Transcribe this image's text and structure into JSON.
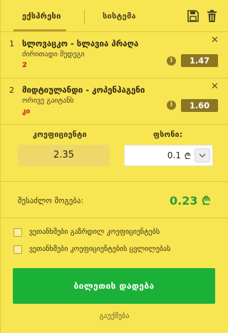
{
  "tabs": [
    {
      "label": "ექსპრესი",
      "active": true
    },
    {
      "label": "სისტემა",
      "active": false
    }
  ],
  "icons": {
    "save": "floppy-disk-icon",
    "trash": "trash-icon",
    "info": "info-icon",
    "close": "close-icon",
    "chevron": "chevron-down-icon"
  },
  "bets": [
    {
      "index": "1",
      "title": "სლოვაცკო - სლავია პრაღა",
      "market": "ძირითადი შედეგი",
      "pick": "2",
      "odds": "1.47"
    },
    {
      "index": "2",
      "title": "მიდტიულანდი - კოპენჰაგენი",
      "market": "ორივე გაიტანს",
      "pick": "კი",
      "odds": "1.60"
    }
  ],
  "calc": {
    "coef_label": "კოეფიციენტი",
    "coef_value": "2.35",
    "stake_label": "ფსონი:",
    "stake_value": "0.1",
    "currency": "₾"
  },
  "win": {
    "label": "შესაძლო მოგება:",
    "value": "0.23",
    "currency": "₾"
  },
  "options": [
    {
      "label": "ვეთანხმები გაზრდილ კოეფიციენტებს",
      "checked": false
    },
    {
      "label": "ვეთანხმები კოეფიციენტების ცვლილებას",
      "checked": false
    }
  ],
  "actions": {
    "place_bet": "ბილეთის დადება",
    "cancel": "გაუქმება"
  },
  "colors": {
    "background": "#f8e552",
    "odds_badge": "#8c7622",
    "win_green": "#2e9d2e",
    "button_green": "#1bb139",
    "pick_red": "#d01a1a"
  }
}
